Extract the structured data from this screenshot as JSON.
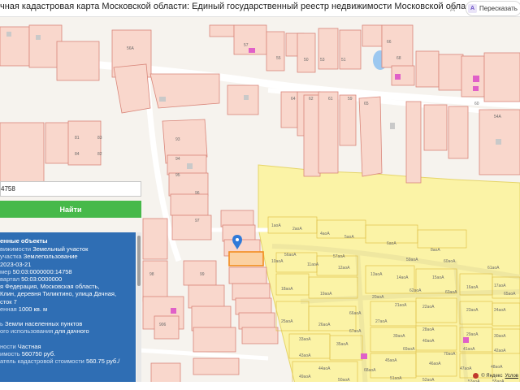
{
  "window": {
    "title": "чная кадастровая карта Московской области: Единый государственный реестр недвижимости Московской области",
    "translate_label": "Пересказать"
  },
  "search": {
    "value": "4758",
    "button_label": "Найти"
  },
  "panel": {
    "heading": "енные объекты",
    "rows": [
      {
        "key": "вижимости",
        "value": "Земельный участок"
      },
      {
        "key": " участка",
        "value": "Землепользование"
      },
      {
        "key": "",
        "value": "2023-03-21"
      },
      {
        "key": "мер",
        "value": "50:03:0000000:14758"
      },
      {
        "key": "вартал",
        "value": "50:03:0000000"
      },
      {
        "key": "",
        "value": "я Федерация, Московская область,"
      },
      {
        "key": "",
        "value": "Клин, деревня Тиликтино, улица Дачная,"
      },
      {
        "key": "",
        "value": "сток 7"
      },
      {
        "key": "енная",
        "value": "1000 кв. м"
      },
      {
        "key": "",
        "value": ""
      },
      {
        "key": "ь",
        "value": "Земли населенных пунктов"
      },
      {
        "key": "ого использования",
        "value": "для дачного"
      },
      {
        "key": "",
        "value": ""
      },
      {
        "key": "ности",
        "value": "Частная"
      },
      {
        "key": "имость",
        "value": "560750 руб."
      },
      {
        "key": "атель кадастровой стоимости",
        "value": "560.75 руб./"
      }
    ]
  },
  "map": {
    "parcel_labels": [
      "56А",
      "66",
      "68",
      "54А",
      "60",
      "50",
      "51",
      "53",
      "55",
      "57",
      "83",
      "81",
      "82",
      "84",
      "93",
      "94",
      "95",
      "96",
      "97",
      "98",
      "99",
      "906",
      "64",
      "62",
      "61",
      "65",
      "59",
      "1аоА",
      "2аоА",
      "4аоА",
      "5аоА",
      "6аоА",
      "8аоА",
      "10аоА",
      "11аоА",
      "12аоА",
      "13аоА",
      "14аоА",
      "15аоА",
      "16аоА",
      "17аоА",
      "18аоА",
      "19аоА",
      "20аоА",
      "21аоА",
      "22аоА",
      "23аоА",
      "24аоА",
      "25аоА",
      "26аоА",
      "27аоА",
      "28аоА",
      "29аоА",
      "30аоА",
      "33аоА",
      "35аоА",
      "39аоА",
      "40аоА",
      "41аоА",
      "42аоА",
      "43аоА",
      "44аоА",
      "45аоА",
      "46аоА",
      "47аоА",
      "48аоА",
      "49аоА",
      "50аоА",
      "51аоА",
      "52аоА",
      "53аоА",
      "55аоА",
      "56аоА",
      "57аоА",
      "59аоА",
      "60аоА",
      "61аоА",
      "62аоА",
      "63аоА",
      "65аоА",
      "66аоА",
      "67аоА",
      "68аоА",
      "69аоА",
      "70аоА"
    ]
  },
  "attribution": {
    "provider": "© Яндекс",
    "terms": "Услов"
  },
  "colors": {
    "parcel_fill": "#f9d7cc",
    "parcel_stroke": "#d9867a",
    "zone_fill": "#fbf3a6",
    "selected_stroke": "#f28c1e",
    "marker": "#2f7ad8",
    "panel_bg": "#2f6eb4",
    "button_bg": "#46b94a",
    "building": "#e060c8"
  }
}
